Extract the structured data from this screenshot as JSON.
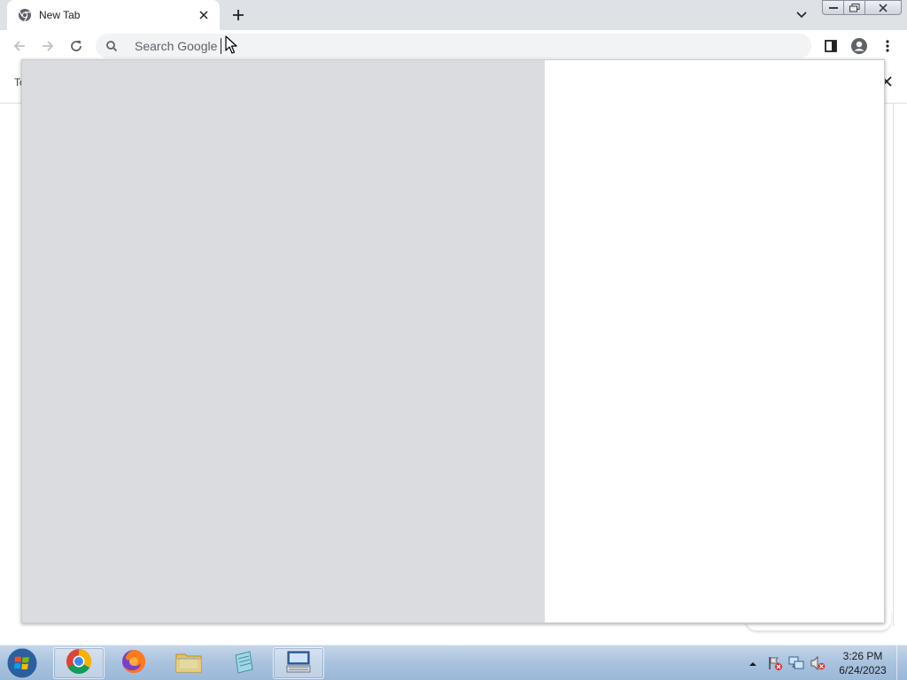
{
  "browser": {
    "tab": {
      "title": "New Tab"
    },
    "omnibox": {
      "placeholder": "Search Google"
    }
  },
  "page": {
    "left_fragment": "To"
  },
  "taskbar": {
    "apps": [
      {
        "name": "chrome",
        "active": true
      },
      {
        "name": "firefox",
        "active": false
      },
      {
        "name": "file-explorer",
        "active": false
      },
      {
        "name": "notepad",
        "active": false
      },
      {
        "name": "on-screen-keyboard",
        "active": true
      }
    ],
    "clock": {
      "time": "3:26 PM",
      "date": "6/24/2023"
    }
  },
  "colors": {
    "tabstrip": "#dee1e6",
    "omnibox": "#f1f3f4",
    "popup_left": "#dadce0",
    "taskbar": "#a9c2de"
  }
}
